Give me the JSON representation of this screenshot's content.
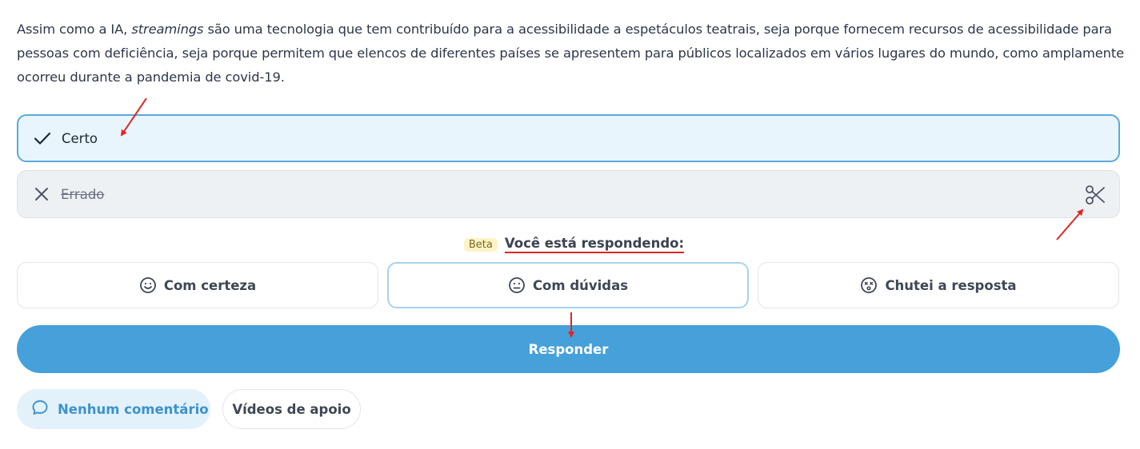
{
  "question": {
    "text_before": "Assim como a IA, ",
    "text_italic": "streamings",
    "text_after": " são uma tecnologia que tem contribuído para a acessibilidade a espetáculos teatrais, seja porque fornecem recursos de acessibilidade para pessoas com deficiência, seja porque permitem que elencos de diferentes países se apresentem para públicos localizados em vários lugares do mundo, como amplamente ocorreu durante a pandemia de covid-19."
  },
  "options": [
    {
      "label": "Certo",
      "icon": "check-icon",
      "state": "selected"
    },
    {
      "label": "Errado",
      "icon": "x-icon",
      "state": "eliminated",
      "tool_icon": "scissors-icon"
    }
  ],
  "confidence": {
    "badge": "Beta",
    "prompt": "Você está respondendo:",
    "buttons": [
      {
        "label": "Com certeza",
        "icon": "smile-icon"
      },
      {
        "label": "Com dúvidas",
        "icon": "neutral-face-icon",
        "selected": true
      },
      {
        "label": "Chutei a resposta",
        "icon": "dizzy-face-icon"
      }
    ]
  },
  "submit_label": "Responder",
  "footer": {
    "comments_label": "Nenhum comentário",
    "comments_icon": "comment-bubble-icon",
    "videos_label": "Vídeos de apoio"
  },
  "colors": {
    "accent": "#46a0da",
    "selected_option_bg": "#e8f5fd",
    "selected_option_border": "#5aa9dc",
    "annotation_arrow": "#e02424",
    "beta_badge_bg": "#fdf3c4"
  }
}
